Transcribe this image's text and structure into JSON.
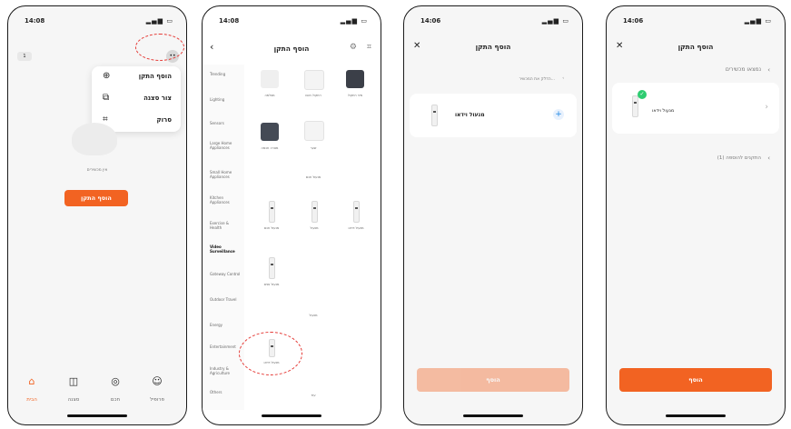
{
  "phone1": {
    "time": "14:08",
    "home_label": "הבית",
    "badge": "1",
    "menu": [
      {
        "label": "הוסף התקן",
        "icon": "add-circle-icon"
      },
      {
        "label": "צור סצנה",
        "icon": "scene-icon"
      },
      {
        "label": "סרוק",
        "icon": "scan-icon"
      }
    ],
    "empty_text": "אין מכשירים",
    "add_button": "הוסף התקן",
    "tabs": [
      {
        "label": "הבית",
        "icon": "home-icon"
      },
      {
        "label": "סצנה",
        "icon": "scene-icon"
      },
      {
        "label": "חכם",
        "icon": "smart-icon"
      },
      {
        "label": "פרופיל",
        "icon": "profile-icon"
      }
    ]
  },
  "phone2": {
    "time": "14:08",
    "title": "הוסף התקן",
    "categories": [
      "Trending",
      "Lighting",
      "Sensors",
      "Large Home Appliances",
      "Small Home Appliances",
      "Kitchen Appliances",
      "Exercise & Health",
      "Video Surveillance",
      "Gateway Control",
      "Outdoor Travel",
      "Energy",
      "Entertainment",
      "Industry & Agriculture",
      "Others"
    ],
    "grid_labels": [
      "מצלמה",
      "רמקול חכם",
      "מיני רמקול",
      "מנורה חכמה",
      "שער",
      "מנעול חכם",
      "מנעול",
      "מנעול וידאו",
      "מנעול פנים"
    ],
    "section_a": "מנעול חכם",
    "section_b": "מנעול",
    "highlight_label": "מנעול וידאו",
    "footer": "עוד"
  },
  "phone3": {
    "time": "14:06",
    "title": "הוסף התקן",
    "hint": "הדלק את המכשיר...",
    "device": "מנעול וידאו",
    "button": "הוסף"
  },
  "phone4": {
    "time": "14:06",
    "title": "הוסף התקן",
    "found": "נמצאו מכשירים",
    "device": "מנעול וידאו",
    "pending": "(1) התקנים להוספה",
    "button": "הוסף"
  },
  "colors": {
    "accent": "#f26322",
    "blue": "#1e88e5",
    "green": "#2ecc71",
    "highlight": "#e53935"
  }
}
